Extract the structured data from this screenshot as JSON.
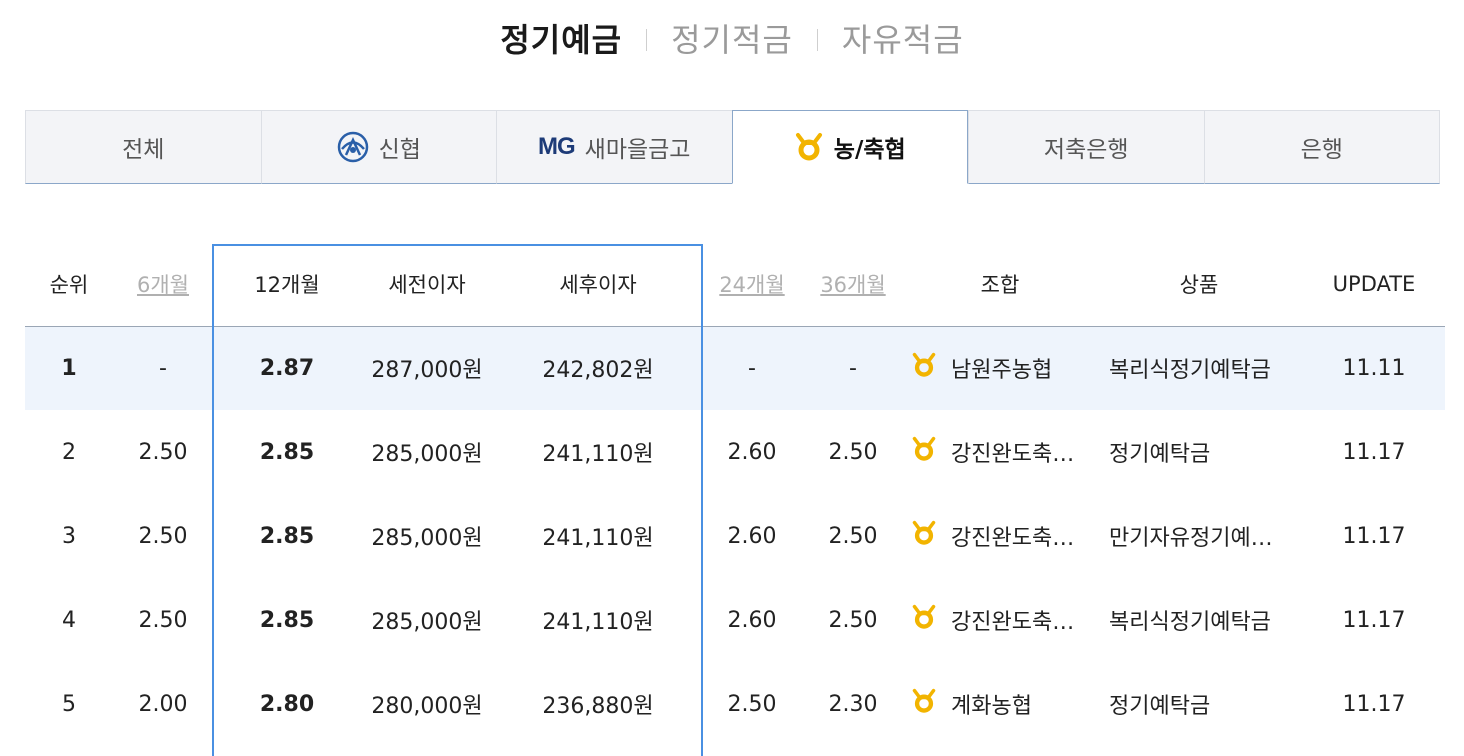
{
  "top_tabs": [
    {
      "label": "정기예금",
      "active": true
    },
    {
      "label": "정기적금",
      "active": false
    },
    {
      "label": "자유적금",
      "active": false
    }
  ],
  "category_tabs": [
    {
      "label": "전체",
      "icon": null
    },
    {
      "label": "신협",
      "icon": "shinhyup-logo-icon"
    },
    {
      "label": "새마을금고",
      "icon": "mg-logo-icon",
      "icon_text": "MG"
    },
    {
      "label": "농/축협",
      "icon": "nh-logo-icon"
    },
    {
      "label": "저축은행",
      "icon": null
    },
    {
      "label": "은행",
      "icon": null
    }
  ],
  "active_category": "농/축협",
  "table": {
    "headers": {
      "rank": "순위",
      "m6": "6개월",
      "m12": "12개월",
      "pre_tax": "세전이자",
      "post_tax": "세후이자",
      "m24": "24개월",
      "m36": "36개월",
      "bank": "조합",
      "product": "상품",
      "update": "UPDATE"
    },
    "rows": [
      {
        "rank": "1",
        "m6": "-",
        "m12": "2.87",
        "pre_tax": "287,000원",
        "post_tax": "242,802원",
        "m24": "-",
        "m36": "-",
        "bank": "남원주농협",
        "product": "복리식정기예탁금",
        "update": "11.11"
      },
      {
        "rank": "2",
        "m6": "2.50",
        "m12": "2.85",
        "pre_tax": "285,000원",
        "post_tax": "241,110원",
        "m24": "2.60",
        "m36": "2.50",
        "bank": "강진완도축…",
        "product": "정기예탁금",
        "update": "11.17"
      },
      {
        "rank": "3",
        "m6": "2.50",
        "m12": "2.85",
        "pre_tax": "285,000원",
        "post_tax": "241,110원",
        "m24": "2.60",
        "m36": "2.50",
        "bank": "강진완도축…",
        "product": "만기자유정기예…",
        "update": "11.17"
      },
      {
        "rank": "4",
        "m6": "2.50",
        "m12": "2.85",
        "pre_tax": "285,000원",
        "post_tax": "241,110원",
        "m24": "2.60",
        "m36": "2.50",
        "bank": "강진완도축…",
        "product": "복리식정기예탁금",
        "update": "11.17"
      },
      {
        "rank": "5",
        "m6": "2.00",
        "m12": "2.80",
        "pre_tax": "280,000원",
        "post_tax": "236,880원",
        "m24": "2.50",
        "m36": "2.30",
        "bank": "계화농협",
        "product": "정기예탁금",
        "update": "11.17"
      }
    ]
  },
  "colors": {
    "rate_highlight": "#c0325b",
    "highlight_box": "#4a90e2",
    "first_row_bg": "#eef4fc",
    "nh_logo": "#f2b400",
    "mg_logo": "#1d3b78"
  }
}
